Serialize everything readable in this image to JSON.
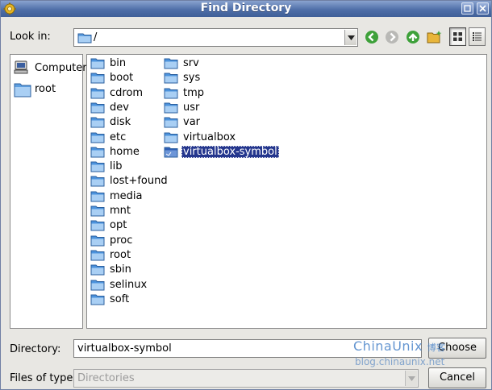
{
  "window": {
    "title": "Find Directory"
  },
  "toolbar": {
    "look_in_label": "Look in:",
    "path_value": "/"
  },
  "sidebar": {
    "items": [
      {
        "label": "Computer",
        "icon": "computer-icon"
      },
      {
        "label": "root",
        "icon": "folder-icon"
      }
    ]
  },
  "files": {
    "column1": [
      "bin",
      "boot",
      "cdrom",
      "dev",
      "disk",
      "etc",
      "home",
      "lib",
      "lost+found",
      "media",
      "mnt",
      "opt",
      "proc",
      "root",
      "sbin",
      "selinux",
      "soft"
    ],
    "column2": [
      "srv",
      "sys",
      "tmp",
      "usr",
      "var",
      "virtualbox",
      "virtualbox-symbol"
    ],
    "selected": "virtualbox-symbol"
  },
  "footer": {
    "directory_label": "Directory:",
    "directory_value": "virtualbox-symbol",
    "files_of_type_label": "Files of type:",
    "files_of_type_value": "Directories",
    "choose_label": "Choose",
    "cancel_label": "Cancel"
  },
  "watermark": {
    "main": "ChinaUnix",
    "badge": "博客",
    "sub": "blog.chinaunix.net"
  },
  "colors": {
    "titlebar": "#4f6fa8",
    "selection": "#25378e",
    "folder": "#3f86d4"
  }
}
